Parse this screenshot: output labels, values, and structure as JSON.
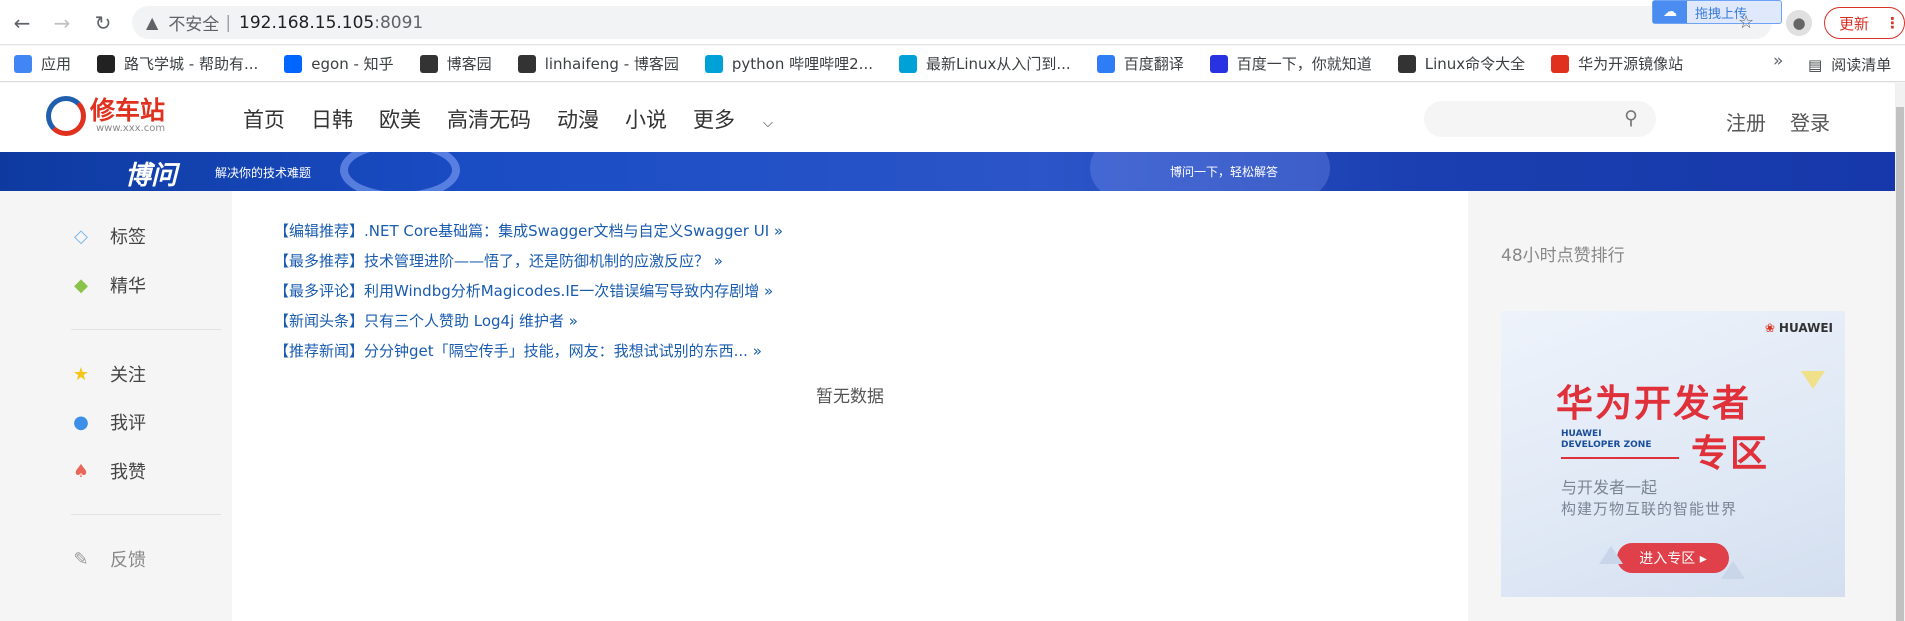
{
  "browser": {
    "url_warning": "不安全",
    "url_host": "192.168.15.105",
    "url_port": ":8091",
    "ext_upload_label": "拖拽上传",
    "update_label": "更新",
    "bookmarks": [
      {
        "label": "应用",
        "icon": "apps-grid-icon",
        "color": "#4285f4"
      },
      {
        "label": "路飞学城 - 帮助有...",
        "icon": "luffy-icon",
        "color": "#222222"
      },
      {
        "label": "egon - 知乎",
        "icon": "zhihu-icon",
        "color": "#0066ff"
      },
      {
        "label": "博客园",
        "icon": "cnblogs-icon",
        "color": "#333333"
      },
      {
        "label": "linhaifeng - 博客园",
        "icon": "cnblogs-icon",
        "color": "#333333"
      },
      {
        "label": "python 哔哩哔哩2...",
        "icon": "bilibili-icon",
        "color": "#00a1d6"
      },
      {
        "label": "最新Linux从入门到...",
        "icon": "bilibili-icon",
        "color": "#00a1d6"
      },
      {
        "label": "百度翻译",
        "icon": "baidu-translate-icon",
        "color": "#2e7cf6"
      },
      {
        "label": "百度一下，你就知道",
        "icon": "baidu-icon",
        "color": "#2932e1"
      },
      {
        "label": "Linux命令大全",
        "icon": "linux-cmd-icon",
        "color": "#333333"
      },
      {
        "label": "华为开源镜像站",
        "icon": "huawei-icon",
        "color": "#e0301e"
      }
    ],
    "more_label": "»",
    "reading_list_label": "阅读清单"
  },
  "site": {
    "logo_text": "修车站",
    "logo_sub": "www.xxx.com",
    "nav": [
      "首页",
      "日韩",
      "欧美",
      "高清无码",
      "动漫",
      "小说",
      "更多"
    ],
    "register_label": "注册",
    "login_label": "登录",
    "banner": {
      "title": "博问",
      "subtitle": "解决你的技术难题",
      "right_text": "博问一下，轻松解答"
    }
  },
  "sidebar": {
    "groups": [
      [
        {
          "label": "标签",
          "icon": "tag-icon",
          "color": "#7ab6f0"
        },
        {
          "label": "精华",
          "icon": "diamond-icon",
          "color": "#8bc34a"
        }
      ],
      [
        {
          "label": "关注",
          "icon": "star-icon",
          "color": "#f5c518"
        },
        {
          "label": "我评",
          "icon": "comment-icon",
          "color": "#3d8ee8"
        },
        {
          "label": "我赞",
          "icon": "thumbs-up-icon",
          "color": "#e8665a"
        }
      ],
      [
        {
          "label": "反馈",
          "icon": "edit-icon",
          "color": "#999999"
        }
      ]
    ]
  },
  "news": [
    "【编辑推荐】.NET Core基础篇：集成Swagger文档与自定义Swagger UI »",
    "【最多推荐】技术管理进阶——悟了，还是防御机制的应激反应？ »",
    "【最多评论】利用Windbg分析Magicodes.IE一次错误编写导致内存剧增 »",
    "【新闻头条】只有三个人赞助 Log4j 维护者 »",
    "【推荐新闻】分分钟get「隔空传手」技能，网友：我想试试别的东西... »"
  ],
  "empty_text": "暂无数据",
  "right": {
    "hot_title": "48小时点赞排行",
    "ad": {
      "brand": "HUAWEI",
      "headline1": "华为开发者",
      "headline2": "专区",
      "small1": "HUAWEI",
      "small2": "DEVELOPER ZONE",
      "sub1": "与开发者一起",
      "sub2": "构建万物互联的智能世界",
      "button": "进入专区 ▸"
    }
  }
}
